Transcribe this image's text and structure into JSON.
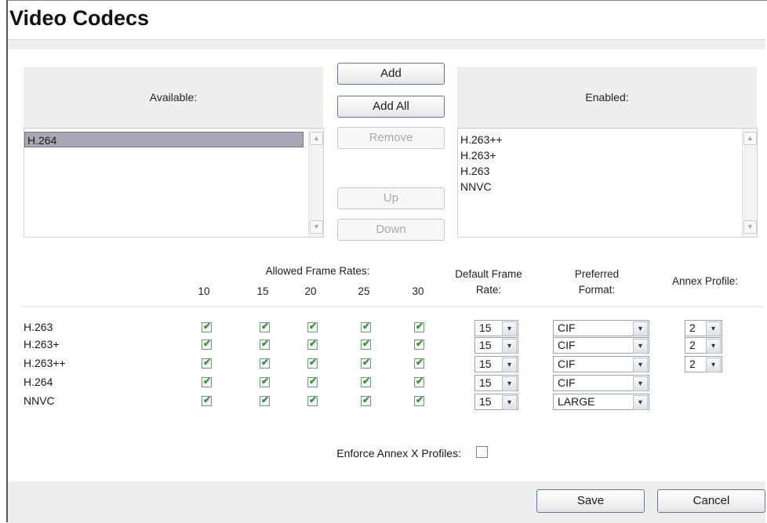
{
  "title": "Video Codecs",
  "available": {
    "label": "Available:",
    "items": [
      "H.264"
    ],
    "selected_index": 0
  },
  "enabled": {
    "label": "Enabled:",
    "items": [
      "H.263++",
      "H.263+",
      "H.263",
      "NNVC"
    ]
  },
  "actions": {
    "add": "Add",
    "add_all": "Add All",
    "remove": "Remove",
    "up": "Up",
    "down": "Down"
  },
  "table": {
    "allowed_frame_rates_label": "Allowed Frame Rates:",
    "frame_rates": [
      "10",
      "15",
      "20",
      "25",
      "30"
    ],
    "default_frame_rate_label": "Default Frame Rate:",
    "preferred_format_label": "Preferred Format:",
    "annex_profile_label": "Annex Profile:",
    "rows": [
      {
        "name": "H.263",
        "checks": [
          true,
          true,
          true,
          true,
          true
        ],
        "default_rate": "15",
        "format": "CIF",
        "annex": "2"
      },
      {
        "name": "H.263+",
        "checks": [
          true,
          true,
          true,
          true,
          true
        ],
        "default_rate": "15",
        "format": "CIF",
        "annex": "2"
      },
      {
        "name": "H.263++",
        "checks": [
          true,
          true,
          true,
          true,
          true
        ],
        "default_rate": "15",
        "format": "CIF",
        "annex": "2"
      },
      {
        "name": "H.264",
        "checks": [
          true,
          true,
          true,
          true,
          true
        ],
        "default_rate": "15",
        "format": "CIF",
        "annex": null
      },
      {
        "name": "NNVC",
        "checks": [
          true,
          true,
          true,
          true,
          true
        ],
        "default_rate": "15",
        "format": "LARGE",
        "annex": null
      }
    ]
  },
  "enforce_annex_x": {
    "label": "Enforce Annex X Profiles:",
    "checked": false
  },
  "footer": {
    "save": "Save",
    "cancel": "Cancel"
  },
  "colors": {
    "check_green": "#2d9a2d",
    "button_border": "#5a78a8",
    "selection": "#a7a7b7"
  },
  "icons": {
    "checkbox_tick": "check-icon",
    "dropdown": "chevron-down-icon",
    "scroll_up": "chevron-up-icon"
  }
}
